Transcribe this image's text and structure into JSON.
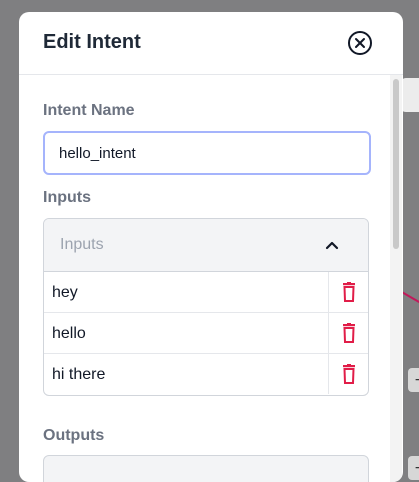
{
  "modal": {
    "title": "Edit Intent"
  },
  "intent_name": {
    "label": "Intent Name",
    "value": "hello_intent"
  },
  "inputs": {
    "label": "Inputs",
    "accordion_title": "Inputs",
    "expanded": true,
    "items": [
      "hey",
      "hello",
      "hi there"
    ]
  },
  "outputs": {
    "label": "Outputs"
  },
  "icons": {
    "close": "close-circle-icon",
    "chevron": "chevron-up-icon",
    "delete": "trash-icon"
  },
  "colors": {
    "delete": "#e11d48",
    "focus_border": "#a5b4fc",
    "label": "#6b7280"
  }
}
